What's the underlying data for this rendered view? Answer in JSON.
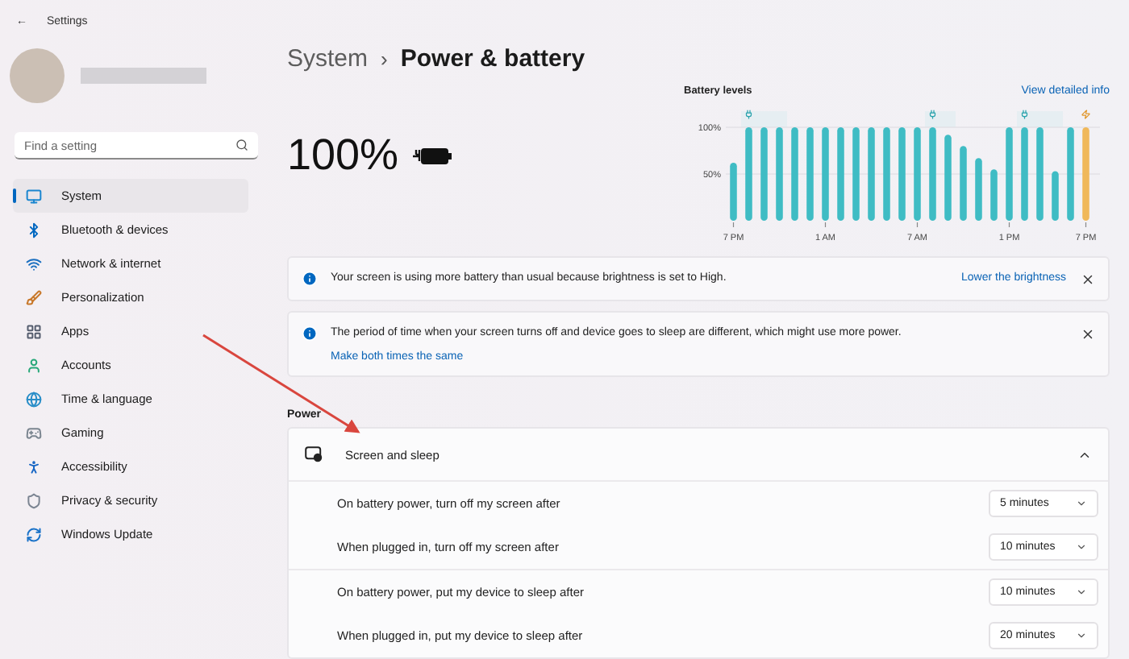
{
  "window": {
    "title": "Settings",
    "back": "←"
  },
  "search": {
    "placeholder": "Find a setting"
  },
  "sidebar": {
    "items": [
      {
        "label": "System",
        "selected": true
      },
      {
        "label": "Bluetooth & devices",
        "selected": false
      },
      {
        "label": "Network & internet",
        "selected": false
      },
      {
        "label": "Personalization",
        "selected": false
      },
      {
        "label": "Apps",
        "selected": false
      },
      {
        "label": "Accounts",
        "selected": false
      },
      {
        "label": "Time & language",
        "selected": false
      },
      {
        "label": "Gaming",
        "selected": false
      },
      {
        "label": "Accessibility",
        "selected": false
      },
      {
        "label": "Privacy & security",
        "selected": false
      },
      {
        "label": "Windows Update",
        "selected": false
      }
    ]
  },
  "breadcrumb": {
    "parent": "System",
    "separator": "›",
    "current": "Power & battery"
  },
  "battery": {
    "percent": "100%",
    "charging": true
  },
  "battery_levels": {
    "title": "Battery levels",
    "link": "View detailed info",
    "bar_marks": [
      {
        "kind": "none"
      },
      {
        "kind": "plug"
      },
      {
        "kind": "plugged"
      },
      {
        "kind": "plugged"
      },
      {
        "kind": "none"
      },
      {
        "kind": "none"
      },
      {
        "kind": "none"
      },
      {
        "kind": "none"
      },
      {
        "kind": "none"
      },
      {
        "kind": "none"
      },
      {
        "kind": "none"
      },
      {
        "kind": "none"
      },
      {
        "kind": "none"
      },
      {
        "kind": "plug"
      },
      {
        "kind": "plugged"
      },
      {
        "kind": "none"
      },
      {
        "kind": "none"
      },
      {
        "kind": "none"
      },
      {
        "kind": "none"
      },
      {
        "kind": "plug"
      },
      {
        "kind": "plugged"
      },
      {
        "kind": "plugged"
      },
      {
        "kind": "none"
      },
      {
        "kind": "charging"
      }
    ],
    "chart_data": {
      "type": "bar",
      "categories": [
        "7 PM",
        null,
        null,
        null,
        null,
        null,
        "1 AM",
        null,
        null,
        null,
        null,
        null,
        "7 AM",
        null,
        null,
        null,
        null,
        null,
        "1 PM",
        null,
        null,
        null,
        null,
        "7 PM"
      ],
      "series": [
        {
          "color": "#3fbcc4",
          "values": [
            62,
            100,
            100,
            100,
            100,
            100,
            100,
            100,
            100,
            100,
            100,
            100,
            100,
            100,
            92,
            80,
            67,
            55,
            100,
            100,
            100,
            53,
            100,
            null
          ]
        },
        {
          "color": "#f0b85a",
          "values": [
            null,
            null,
            null,
            null,
            null,
            null,
            null,
            null,
            null,
            null,
            null,
            null,
            null,
            null,
            null,
            null,
            null,
            null,
            null,
            null,
            null,
            null,
            null,
            100
          ]
        }
      ],
      "ylim": [
        0,
        100
      ],
      "yticks": [
        {
          "value": 50,
          "label": "50%"
        },
        {
          "value": 100,
          "label": "100%"
        }
      ]
    }
  },
  "notices": [
    {
      "text": "Your screen is using more battery than usual because brightness is set to High.",
      "link": "Lower the brightness",
      "kind": "inline"
    },
    {
      "text": "The period of time when your screen turns off and device goes to sleep are different, which might use more power.",
      "link": "Make both times the same",
      "kind": "below"
    }
  ],
  "power": {
    "heading": "Power",
    "section": {
      "title": "Screen and sleep",
      "expanded": true,
      "rows": [
        {
          "label": "On battery power, turn off my screen after",
          "value": "5 minutes"
        },
        {
          "label": "When plugged in, turn off my screen after",
          "value": "10 minutes"
        },
        {
          "label": "On battery power, put my device to sleep after",
          "value": "10 minutes"
        },
        {
          "label": "When plugged in, put my device to sleep after",
          "value": "20 minutes"
        }
      ]
    }
  }
}
